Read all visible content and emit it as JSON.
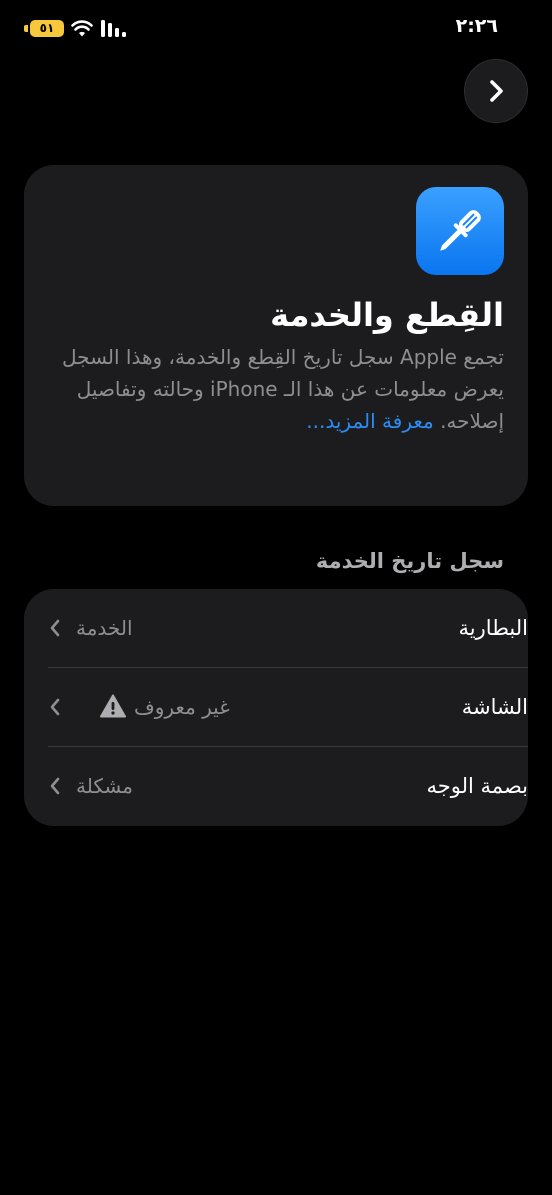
{
  "status_bar": {
    "time": "٢:٢٦",
    "battery_level": "٥١",
    "battery_color": "#f8c83c"
  },
  "nav": {
    "forward_icon": "chevron-right-icon"
  },
  "info_card": {
    "icon": "screwdriver-icon",
    "icon_color": "#1a86f5",
    "title": "القِطع والخدمة",
    "description": "تجمع Apple سجل تاريخ القِطع والخدمة، وهذا السجل يعرض معلومات عن هذا الـ iPhone وحالته وتفاصيل إصلاحه.",
    "learn_more": "معرفة المزيد..."
  },
  "service_history": {
    "header": "سجل تاريخ الخدمة",
    "items": [
      {
        "label": "البطارية",
        "value": "الخدمة",
        "warning": false
      },
      {
        "label": "الشاشة",
        "value": "غير معروف",
        "warning": true
      },
      {
        "label": "بصمة الوجه",
        "value": "مشكلة",
        "warning": false
      }
    ]
  },
  "colors": {
    "background": "#000000",
    "card": "#1c1c1e",
    "accent": "#2a8cf4",
    "secondary_text": "#8e8e93"
  }
}
